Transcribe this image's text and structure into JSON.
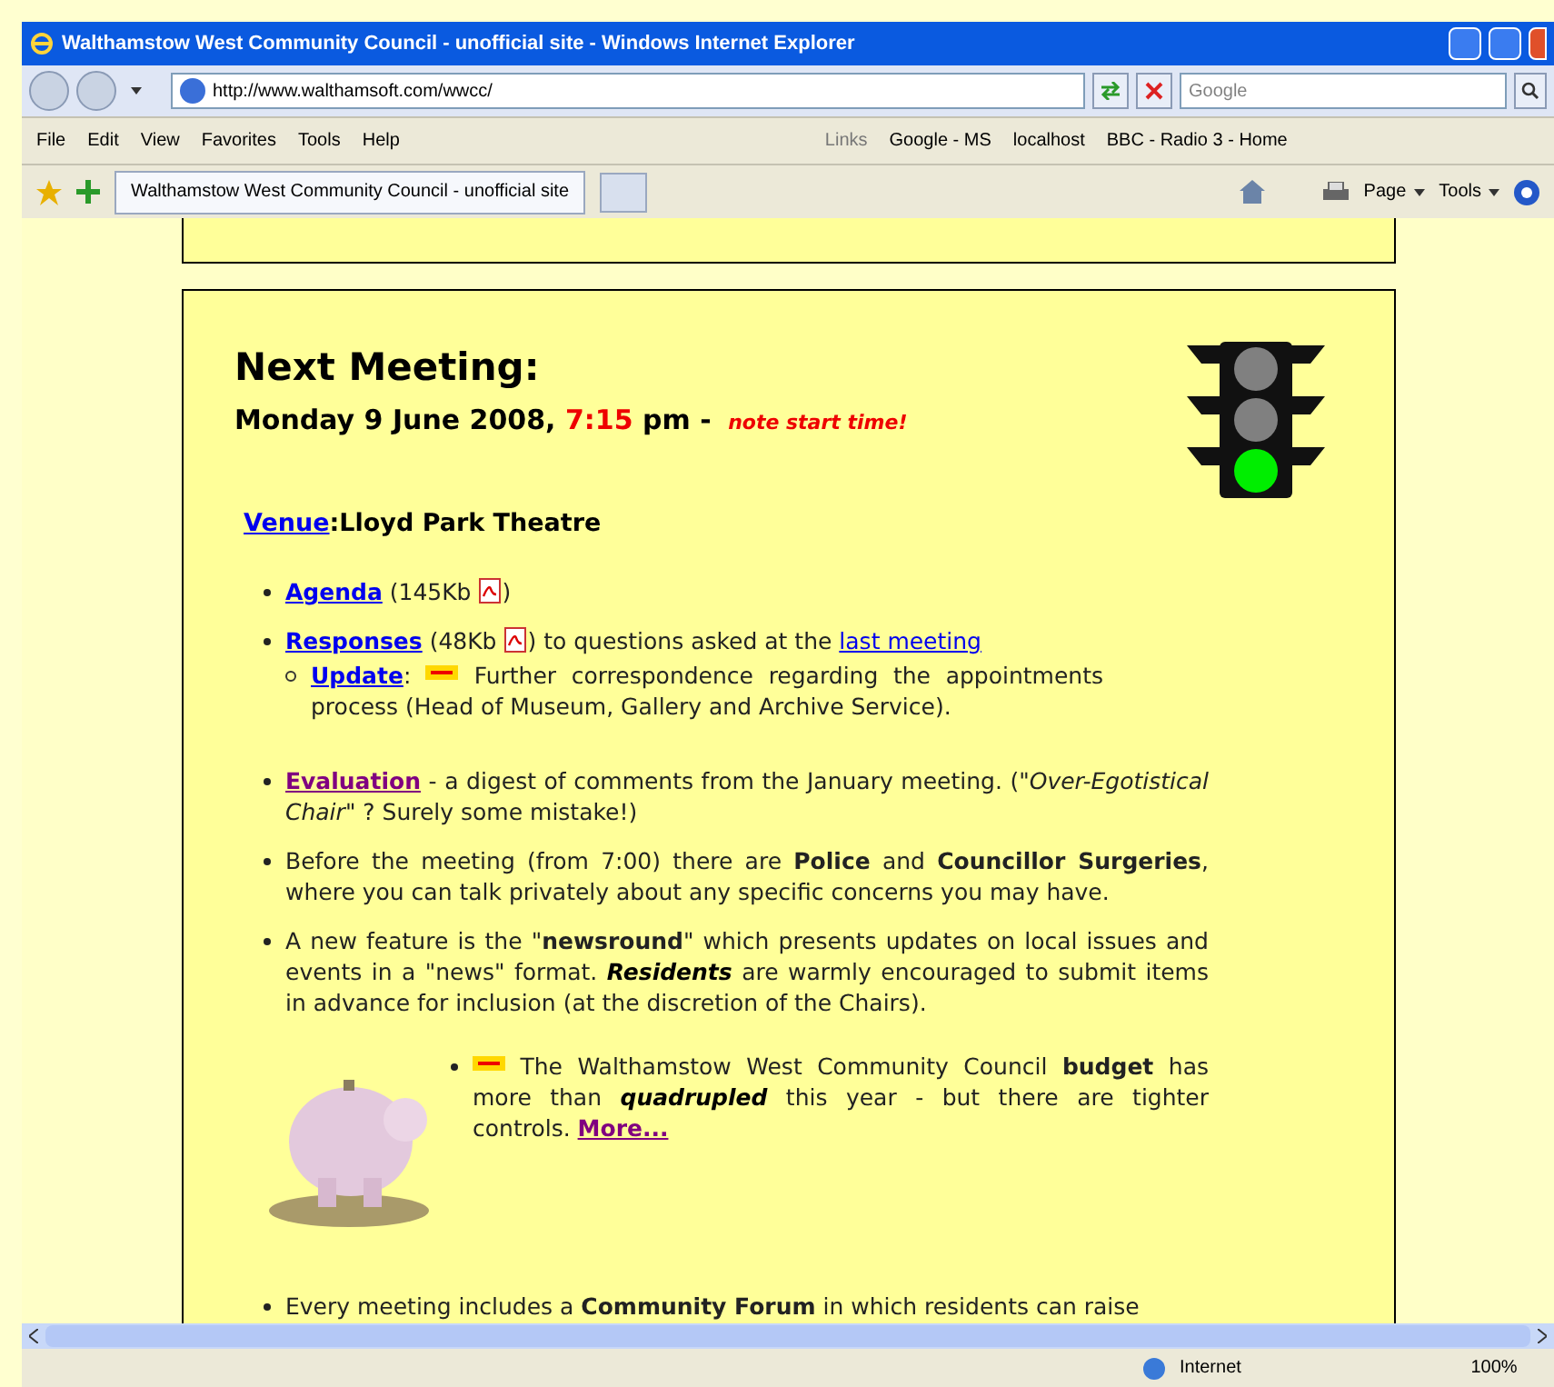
{
  "window": {
    "title": "Walthamstow West Community Council - unofficial site - Windows Internet Explorer"
  },
  "address_bar": {
    "value": "http://www.walthamsoft.com/wwcc/"
  },
  "search": {
    "placeholder": "Google"
  },
  "menu": [
    "File",
    "Edit",
    "View",
    "Favorites",
    "Tools",
    "Help"
  ],
  "links_bar": {
    "label": "Links",
    "items": [
      "Google - MS",
      "localhost",
      "BBC - Radio 3 - Home"
    ]
  },
  "tabs": [
    {
      "label": "Walthamstow West Community Council - unofficial site",
      "selected": true
    }
  ],
  "command_bar": [
    "Page",
    "Tools"
  ],
  "page": {
    "heading": "Next Meeting:",
    "date": "Monday 9 June 2008, ",
    "time": "7:15",
    "date_suffix": " pm - ",
    "note": "note start time!",
    "venue": {
      "link": "Venue",
      "text": ":Lloyd Park Theatre"
    },
    "items": [
      {
        "kind": "plain",
        "segments": [
          {
            "kind": "link",
            "text": "Agenda",
            "bold": true,
            "visited": false
          },
          {
            "kind": "text",
            "text": " (145Kb "
          },
          {
            "kind": "pdf"
          },
          {
            "kind": "text",
            "text": ")"
          }
        ]
      },
      {
        "kind": "plain",
        "segments": [
          {
            "kind": "link",
            "text": "Responses",
            "bold": true,
            "visited": false
          },
          {
            "kind": "text",
            "text": " (48Kb "
          },
          {
            "kind": "pdf"
          },
          {
            "kind": "text",
            "text": ") to questions asked at the "
          },
          {
            "kind": "link",
            "text": "last meeting",
            "bold": false,
            "visited": false
          }
        ],
        "children": [
          {
            "kind": "plain",
            "segments": [
              {
                "kind": "link",
                "text": "Update",
                "bold": true,
                "visited": false
              },
              {
                "kind": "text",
                "text": ": "
              },
              {
                "kind": "new"
              },
              {
                "kind": "text",
                "text": " Further correspondence regarding the appointments process (Head of Museum, Gallery and Archive Service)."
              }
            ]
          }
        ]
      },
      {
        "kind": "plain",
        "segments": [
          {
            "kind": "link",
            "text": "Evaluation",
            "bold": true,
            "visited": true
          },
          {
            "kind": "text",
            "text": " - a digest of comments from the January meeting. (\"*Over-Egotistical Chair*\" ? Surely some mistake!)"
          }
        ]
      },
      {
        "kind": "plain",
        "segments": [
          {
            "kind": "text",
            "text": "Before the meeting (from 7:00) there are **Police** and **Councillor Surgeries**, where you can talk privately about any specific concerns you may have."
          }
        ]
      },
      {
        "kind": "plain",
        "segments": [
          {
            "kind": "text",
            "text": "A new feature is the \"**newsround**\" which presents updates on local issues and events in a \"news\" format. "
          },
          {
            "kind": "emphasis",
            "text": "Residents"
          },
          {
            "kind": "text",
            "text": " are warmly encouraged to submit items in advance for inclusion (at the discretion of the Chairs)."
          }
        ]
      },
      {
        "kind": "picture",
        "segments": [
          {
            "kind": "new"
          },
          {
            "kind": "text",
            "text": " The Walthamstow West Community Council **budget** has more than "
          },
          {
            "kind": "emphasis",
            "text": "quadrupled"
          },
          {
            "kind": "text",
            "text": " this year - but there are tighter controls. "
          },
          {
            "kind": "link",
            "text": "More...",
            "bold": true,
            "visited": true
          }
        ]
      },
      {
        "kind": "plain",
        "segments": [
          {
            "kind": "text",
            "text": "Every meeting includes a **Community Forum** in which residents can raise"
          }
        ]
      }
    ]
  },
  "status_bar": {
    "zone": "Internet",
    "zoom": "100%"
  }
}
